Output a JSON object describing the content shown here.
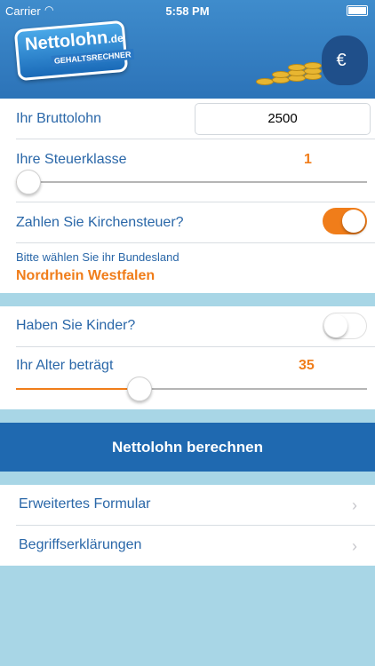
{
  "status_bar": {
    "carrier": "Carrier",
    "time": "5:58 PM"
  },
  "logo": {
    "main": "Nettolohn",
    "domain": ".de",
    "subtitle": "GEHALTSRECHNER"
  },
  "form": {
    "gross_label": "Ihr Bruttolohn",
    "gross_value": "2500",
    "tax_class_label": "Ihre Steuerklasse",
    "tax_class_value": "1",
    "tax_class_slider_fraction": 0.0,
    "church_tax_label": "Zahlen Sie Kirchensteuer?",
    "church_tax_on": true,
    "state_prompt": "Bitte wählen Sie ihr Bundesland",
    "state_value": "Nordrhein Westfalen"
  },
  "form2": {
    "children_label": "Haben Sie Kinder?",
    "children_on": false,
    "age_label": "Ihr Alter beträgt",
    "age_value": "35",
    "age_slider_fraction": 0.34
  },
  "calculate_button": "Nettolohn berechnen",
  "nav": {
    "items": [
      {
        "label": "Erweitertes Formular"
      },
      {
        "label": "Begriffserklärungen"
      }
    ]
  },
  "colors": {
    "accent": "#f07d1a",
    "primary": "#1f69b0",
    "label": "#2a67a8"
  }
}
